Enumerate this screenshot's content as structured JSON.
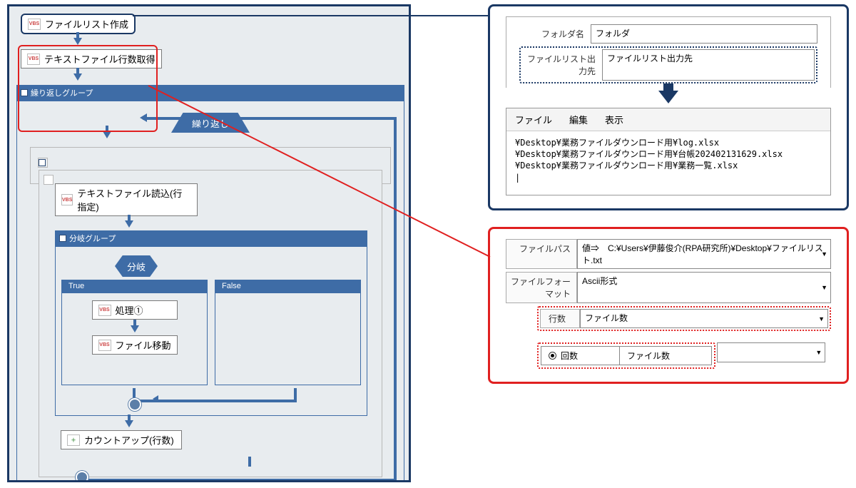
{
  "flow": {
    "n1": "ファイルリスト作成",
    "n2": "テキストファイル行数取得",
    "loop_group": "繰り返しグループ",
    "loop_shape": "繰り返し",
    "n3": "テキストファイル読込(行指定)",
    "branch_group": "分岐グループ",
    "branch_shape": "分岐",
    "true_label": "True",
    "false_label": "False",
    "p1": "処理①",
    "p2": "ファイル移動",
    "n4": "カウントアップ(行数)"
  },
  "panel1": {
    "folder_label": "フォルダ名",
    "folder_value": "フォルダ",
    "output_label": "ファイルリスト出力先",
    "output_value": "ファイルリスト出力先",
    "menu_file": "ファイル",
    "menu_edit": "編集",
    "menu_view": "表示",
    "line1": "¥Desktop¥業務ファイルダウンロード用¥log.xlsx",
    "line2": "¥Desktop¥業務ファイルダウンロード用¥台帳202402131629.xlsx",
    "line3": "¥Desktop¥業務ファイルダウンロード用¥業務一覧.xlsx"
  },
  "panel2": {
    "path_label": "ファイルパス",
    "path_value": "値⇒　C:¥Users¥伊藤俊介(RPA研究所)¥Desktop¥ファイルリスト.txt",
    "format_label": "ファイルフォーマット",
    "format_value": "Ascii形式",
    "rows_label": "行数",
    "rows_value": "ファイル数",
    "count_label": "回数",
    "count_value": "ファイル数"
  }
}
